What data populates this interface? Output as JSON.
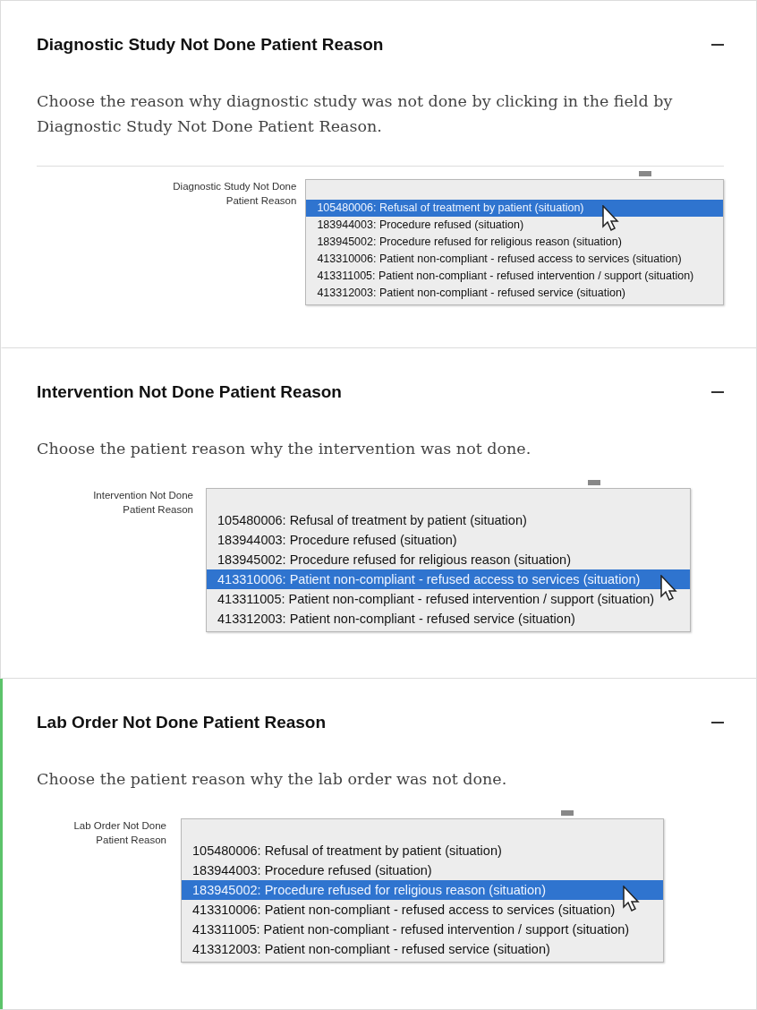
{
  "sections": [
    {
      "title": "Diagnostic Study Not Done Patient Reason",
      "active": false,
      "description": "Choose the reason why diagnostic study was not done by clicking in the field by Diagnostic Study Not Done Patient Reason.",
      "field_label": "Diagnostic Study Not Done Patient Reason",
      "options": [
        {
          "text": "105480006: Refusal of treatment by patient (situation)",
          "selected": true
        },
        {
          "text": "183944003: Procedure refused (situation)",
          "selected": false
        },
        {
          "text": "183945002: Procedure refused for religious reason (situation)",
          "selected": false
        },
        {
          "text": "413310006: Patient non-compliant - refused access to services (situation)",
          "selected": false
        },
        {
          "text": "413311005: Patient non-compliant - refused intervention / support (situation)",
          "selected": false
        },
        {
          "text": "413312003: Patient non-compliant - refused service (situation)",
          "selected": false
        }
      ]
    },
    {
      "title": "Intervention Not Done Patient Reason",
      "active": false,
      "description": "Choose the patient reason why the intervention was not done.",
      "field_label": "Intervention Not Done Patient Reason",
      "options": [
        {
          "text": "105480006: Refusal of treatment by patient (situation)",
          "selected": false
        },
        {
          "text": "183944003: Procedure refused (situation)",
          "selected": false
        },
        {
          "text": "183945002: Procedure refused for religious reason (situation)",
          "selected": false
        },
        {
          "text": "413310006: Patient non-compliant - refused access to services (situation)",
          "selected": true
        },
        {
          "text": "413311005: Patient non-compliant - refused intervention / support (situation)",
          "selected": false
        },
        {
          "text": "413312003: Patient non-compliant - refused service (situation)",
          "selected": false
        }
      ]
    },
    {
      "title": "Lab Order Not Done Patient Reason",
      "active": true,
      "description": "Choose the patient reason why the lab order was not done.",
      "field_label": "Lab Order Not Done Patient Reason",
      "options": [
        {
          "text": "105480006: Refusal of treatment by patient (situation)",
          "selected": false
        },
        {
          "text": "183944003: Procedure refused (situation)",
          "selected": false
        },
        {
          "text": "183945002: Procedure refused for religious reason (situation)",
          "selected": true
        },
        {
          "text": "413310006: Patient non-compliant - refused access to services (situation)",
          "selected": false
        },
        {
          "text": "413311005: Patient non-compliant - refused intervention / support (situation)",
          "selected": false
        },
        {
          "text": "413312003: Patient non-compliant - refused service (situation)",
          "selected": false
        }
      ]
    }
  ]
}
